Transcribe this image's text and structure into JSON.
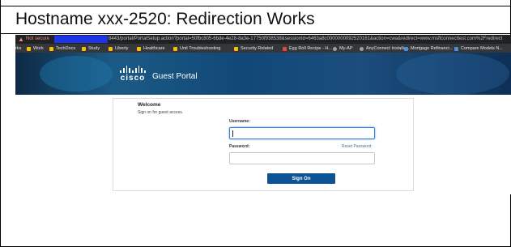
{
  "document": {
    "heading": "Hostname xxx-2520: Redirection Works"
  },
  "browser": {
    "security_label": "Not secure",
    "url_text": "8443/portal/PortalSetup.action?portal=50fbc805-6bde-4e28-8a3e-17750f938538&sessionId=6463a8c0000000092520161&action=cwa&redirect=www.msftconnecttest.com%2Fredirect",
    "bookmarks": [
      {
        "label": "Work",
        "icon": "folder-icon"
      },
      {
        "label": "TechDocs",
        "icon": "folder-icon"
      },
      {
        "label": "Study",
        "icon": "folder-icon"
      },
      {
        "label": "Liberty",
        "icon": "folder-icon"
      },
      {
        "label": "Healthcare",
        "icon": "folder-icon"
      },
      {
        "label": "Unit Troubleshooting",
        "icon": "folder-icon"
      },
      {
        "label": "Security Related",
        "icon": "folder-icon"
      },
      {
        "label": "Egg Roll Recipe - H...",
        "icon": "recipe-icon"
      },
      {
        "label": "My-AP",
        "icon": "globe-icon"
      },
      {
        "label": "AnyConnect Installa...",
        "icon": "globe-icon"
      },
      {
        "label": "Mortgage Refinanci...",
        "icon": "bookmark-icon"
      },
      {
        "label": "Compare Models N...",
        "icon": "bookmark-icon"
      }
    ],
    "bookmark_prefix": "rks"
  },
  "portal": {
    "brand": "cisco",
    "title": "Guest Portal",
    "welcome": "Welcome",
    "instructions": "Sign on for guest access.",
    "username_label": "Username:",
    "username_value": "",
    "password_label": "Password:",
    "password_value": "",
    "reset_link": "Reset Password",
    "signon_button": "Sign On"
  },
  "colors": {
    "banner": "#114877",
    "button": "#0b5394",
    "url_redaction": "#1f33e8"
  }
}
